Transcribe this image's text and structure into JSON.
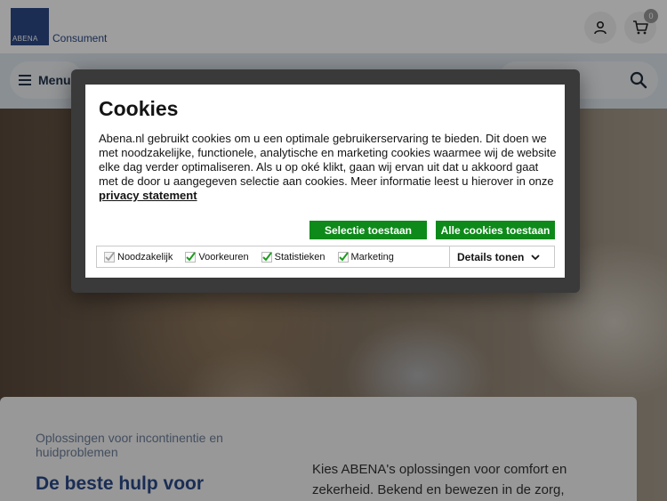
{
  "header": {
    "logo_mark": "ABENA",
    "logo_text": "Consument",
    "cart_count": "0"
  },
  "nav": {
    "menu_label": "Menu"
  },
  "hero": {
    "subtitle": "Oplossingen voor incontinentie en huidproblemen",
    "title": "De beste hulp voor",
    "text": "Kies ABENA's oplossingen voor comfort en zekerheid. Bekend en bewezen in de zorg,"
  },
  "cookie_dialog": {
    "title": "Cookies",
    "body": "Abena.nl gebruikt cookies om u een optimale gebruikerservaring te bieden. Dit doen we met noodzakelijke, functionele, analytische en marketing cookies waarmee wij de website elke dag verder optimaliseren. Als u op oké klikt, gaan wij ervan uit dat u akkoord gaat met de door u aangegeven selectie aan cookies. Meer informatie leest u hierover in onze",
    "link": "privacy statement",
    "btn_selection": "Selectie toestaan",
    "btn_all": "Alle cookies toestaan",
    "options": [
      {
        "label": "Noodzakelijk",
        "checked": true,
        "disabled": true
      },
      {
        "label": "Voorkeuren",
        "checked": true,
        "disabled": false
      },
      {
        "label": "Statistieken",
        "checked": true,
        "disabled": false
      },
      {
        "label": "Marketing",
        "checked": true,
        "disabled": false
      }
    ],
    "details_label": "Details tonen"
  },
  "colors": {
    "brand_blue": "#2c4a87",
    "button_green": "#0e8a1a",
    "check_green": "#1e9c1e"
  }
}
